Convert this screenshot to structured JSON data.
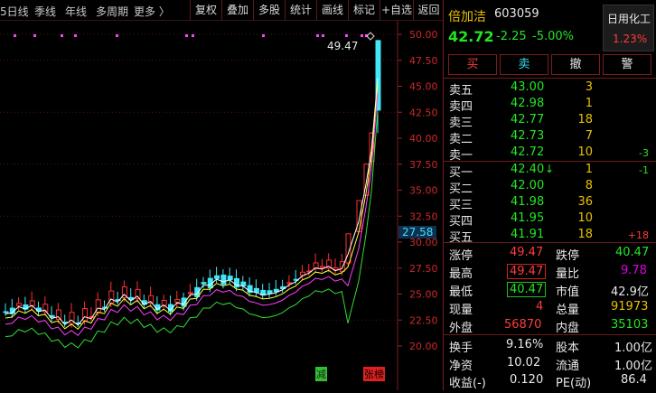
{
  "toolbar": {
    "periods": [
      "5日线",
      "季线",
      "年线",
      "多周期",
      "更多 〉"
    ],
    "buttons": [
      "复权",
      "叠加",
      "多股",
      "统计",
      "画线",
      "标记",
      "+自选",
      "返回"
    ]
  },
  "chart": {
    "price_axis": [
      "50.00",
      "47.50",
      "45.00",
      "42.50",
      "40.00",
      "37.50",
      "35.00",
      "32.50",
      "30.00",
      "27.50",
      "25.00",
      "22.50",
      "20.00"
    ],
    "current_price_tag": "27.58",
    "high_label": "49.47",
    "markers": {
      "reduce": "减",
      "limit_list": "张榜"
    },
    "colors": {
      "up": "#ff3030",
      "down": "#40e8f8",
      "ma5": "#ffffff",
      "ma10": "#ffff40",
      "ma20": "#ff40ff",
      "ma60": "#30e030"
    }
  },
  "stock": {
    "name": "倍加洁",
    "code": "603059",
    "price": "42.72",
    "change": "-2.25",
    "change_pct": "-5.00%",
    "industry": "日用化工",
    "industry_pct": "1.23%"
  },
  "trade_buttons": [
    "买",
    "卖",
    "撤",
    "警"
  ],
  "asks": [
    {
      "label": "卖五",
      "price": "43.00",
      "vol": "3",
      "chg": ""
    },
    {
      "label": "卖四",
      "price": "42.98",
      "vol": "1",
      "chg": ""
    },
    {
      "label": "卖三",
      "price": "42.77",
      "vol": "18",
      "chg": ""
    },
    {
      "label": "卖二",
      "price": "42.73",
      "vol": "7",
      "chg": ""
    },
    {
      "label": "卖一",
      "price": "42.72",
      "vol": "10",
      "chg": "-3"
    }
  ],
  "bids": [
    {
      "label": "买一",
      "price": "42.40",
      "arrow": "↓",
      "vol": "1",
      "chg": "-1"
    },
    {
      "label": "买二",
      "price": "42.00",
      "arrow": "",
      "vol": "8",
      "chg": ""
    },
    {
      "label": "买三",
      "price": "41.98",
      "arrow": "",
      "vol": "36",
      "chg": ""
    },
    {
      "label": "买四",
      "price": "41.95",
      "arrow": "",
      "vol": "10",
      "chg": ""
    },
    {
      "label": "买五",
      "price": "41.91",
      "arrow": "",
      "vol": "18",
      "chg": "+18"
    }
  ],
  "quote": {
    "limit_up_label": "涨停",
    "limit_up": "49.47",
    "limit_down_label": "跌停",
    "limit_down": "40.47",
    "high_label": "最高",
    "high": "49.47",
    "vol_ratio_label": "量比",
    "vol_ratio": "9.78",
    "low_label": "最低",
    "low": "40.47",
    "mkt_cap_label": "市值",
    "mkt_cap": "42.9亿",
    "cur_vol_label": "现量",
    "cur_vol": "4",
    "total_vol_label": "总量",
    "total_vol": "91973",
    "outer_label": "外盘",
    "outer": "56870",
    "inner_label": "内盘",
    "inner": "35103"
  },
  "fundamentals": {
    "turnover_label": "换手",
    "turnover": "9.16%",
    "equity_label": "股本",
    "equity": "1.00亿",
    "nav_label": "净资",
    "nav": "10.02",
    "float_label": "流通",
    "float": "1.00亿",
    "eps_label": "收益(-)",
    "eps": "0.120",
    "pe_label": "PE(动)",
    "pe": "86.4"
  }
}
